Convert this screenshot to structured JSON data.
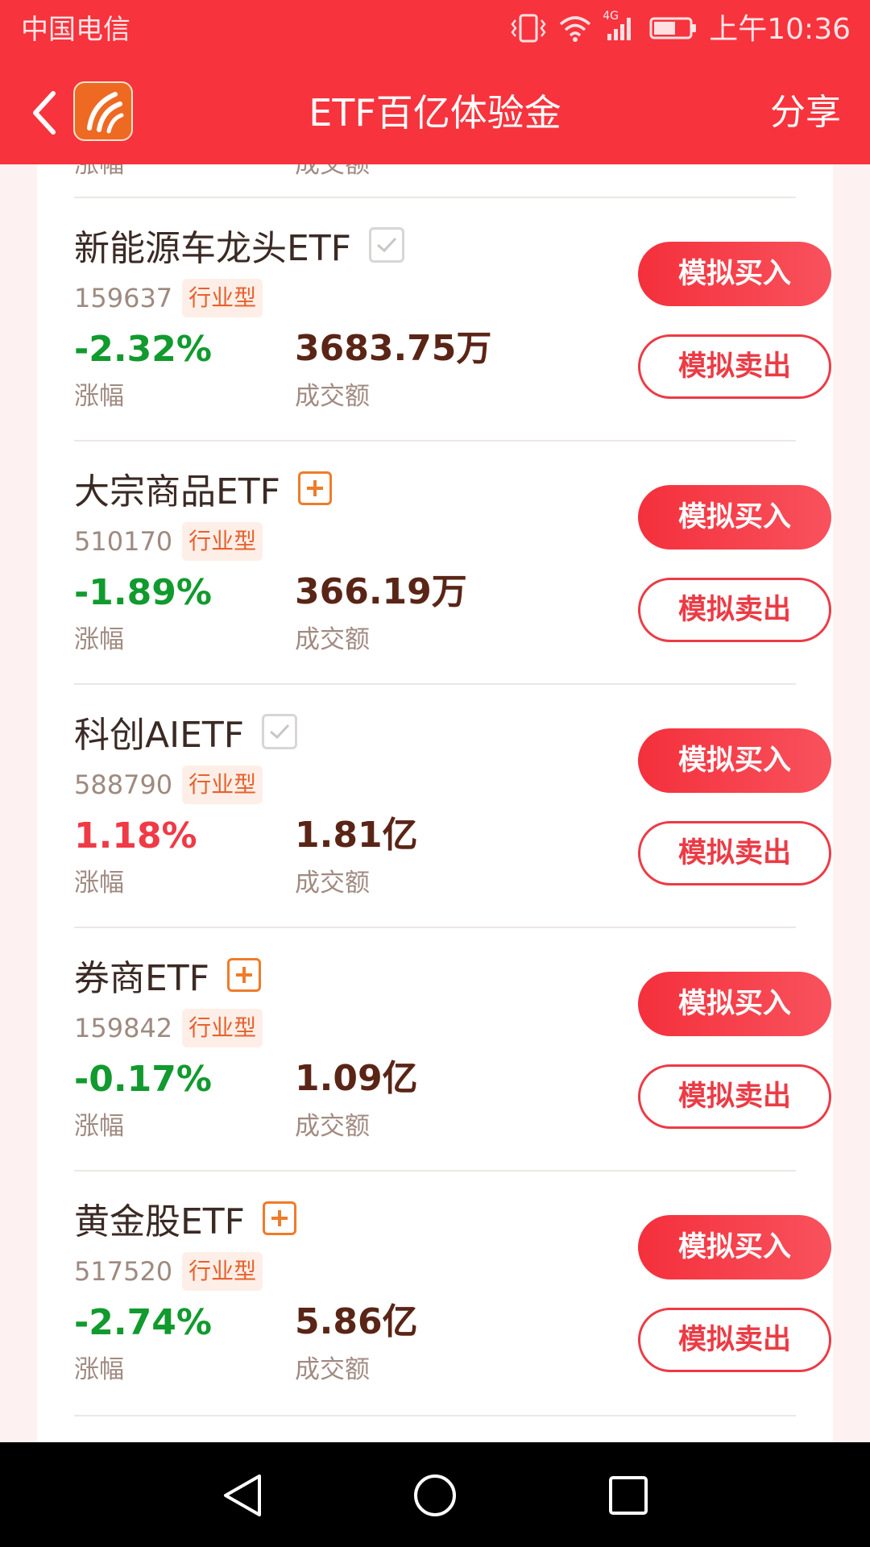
{
  "status_bar": {
    "carrier": "中国电信",
    "network": "4G",
    "time": "上午10:36"
  },
  "nav": {
    "title": "ETF百亿体验金",
    "share": "分享"
  },
  "prev_item": {
    "pct_label": "涨幅",
    "amount_label": "成交额"
  },
  "items": [
    {
      "name": "新能源车龙头ETF",
      "status": "check",
      "code": "159637",
      "tag": "行业型",
      "change": "-2.32%",
      "direction": "down",
      "change_label": "涨幅",
      "amount": "3683.75万",
      "amount_label": "成交额",
      "buy_label": "模拟买入",
      "sell_label": "模拟卖出"
    },
    {
      "name": "大宗商品ETF",
      "status": "add",
      "code": "510170",
      "tag": "行业型",
      "change": "-1.89%",
      "direction": "down",
      "change_label": "涨幅",
      "amount": "366.19万",
      "amount_label": "成交额",
      "buy_label": "模拟买入",
      "sell_label": "模拟卖出"
    },
    {
      "name": "科创AIETF",
      "status": "check",
      "code": "588790",
      "tag": "行业型",
      "change": "1.18%",
      "direction": "up",
      "change_label": "涨幅",
      "amount": "1.81亿",
      "amount_label": "成交额",
      "buy_label": "模拟买入",
      "sell_label": "模拟卖出"
    },
    {
      "name": "券商ETF",
      "status": "add",
      "code": "159842",
      "tag": "行业型",
      "change": "-0.17%",
      "direction": "down",
      "change_label": "涨幅",
      "amount": "1.09亿",
      "amount_label": "成交额",
      "buy_label": "模拟买入",
      "sell_label": "模拟卖出"
    },
    {
      "name": "黄金股ETF",
      "status": "add",
      "code": "517520",
      "tag": "行业型",
      "change": "-2.74%",
      "direction": "down",
      "change_label": "涨幅",
      "amount": "5.86亿",
      "amount_label": "成交额",
      "buy_label": "模拟买入",
      "sell_label": "模拟卖出"
    }
  ],
  "colors": {
    "brand_red": "#f7333d",
    "down_green": "#119a2e",
    "up_red": "#f03a46",
    "amount_brown": "#5a2516",
    "tag_orange": "#e9602d"
  },
  "icons": {
    "back": "chevron-left-icon",
    "logo": "app-logo",
    "vibrate": "vibrate-icon",
    "wifi": "wifi-icon",
    "signal": "signal-icon",
    "battery": "battery-icon",
    "add": "plus-square-icon",
    "check": "check-square-icon",
    "sys_back": "triangle-back-icon",
    "sys_home": "circle-home-icon",
    "sys_recent": "square-recent-icon"
  }
}
